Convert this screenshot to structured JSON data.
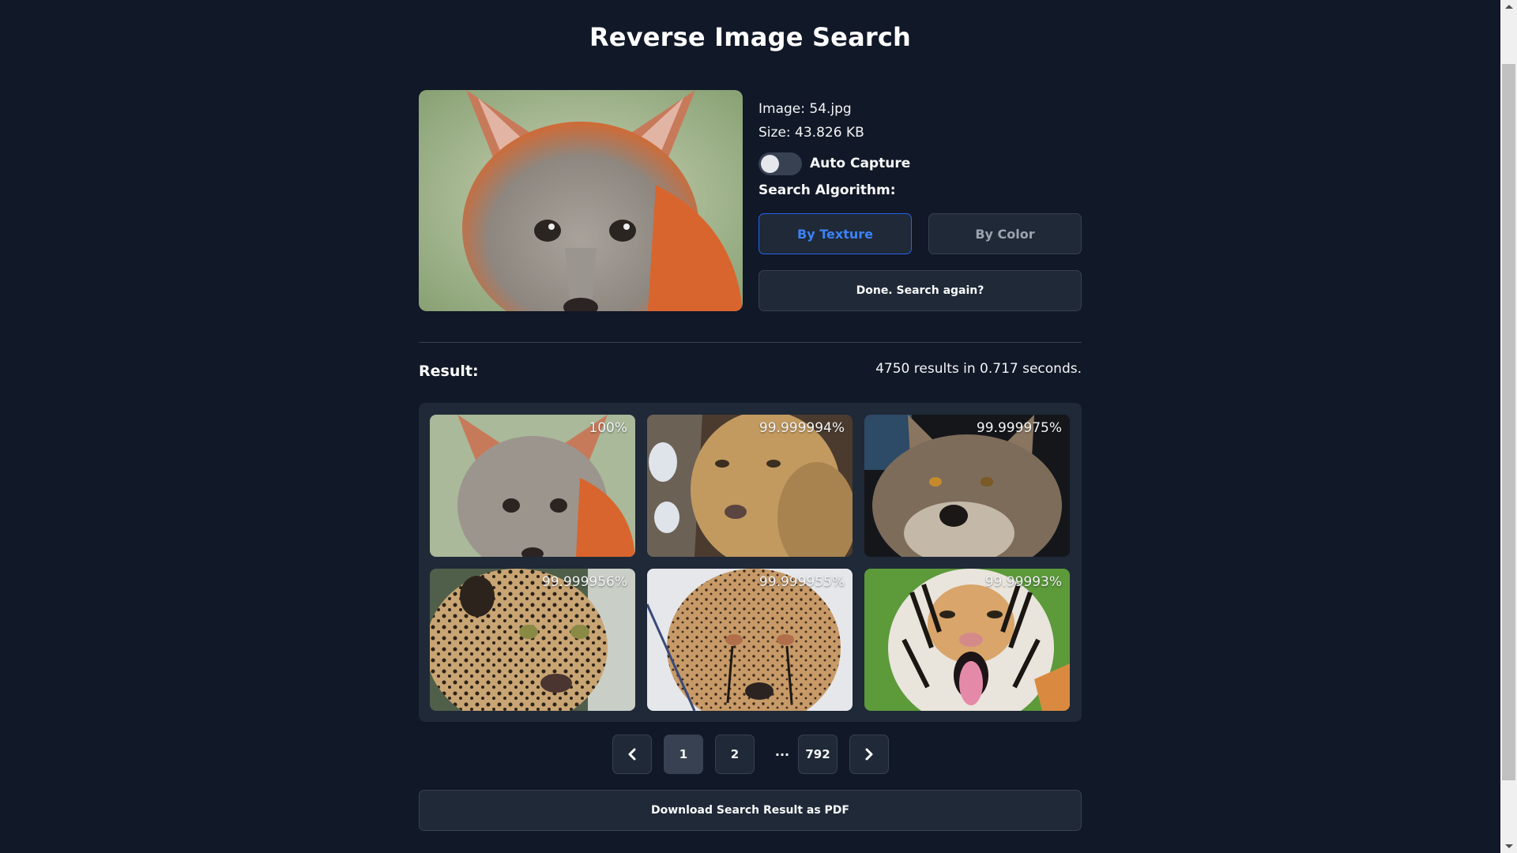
{
  "header": {
    "title": "Reverse Image Search"
  },
  "query": {
    "image_label": "Image: 54.jpg",
    "size_label": "Size: 43.826 KB",
    "image_icon": "fox-photo",
    "auto_capture": {
      "label": "Auto Capture",
      "enabled": false
    },
    "algorithm": {
      "label": "Search Algorithm:",
      "options": [
        {
          "label": "By Texture",
          "selected": true
        },
        {
          "label": "By Color",
          "selected": false
        }
      ]
    },
    "search_again_label": "Done. Search again?"
  },
  "results": {
    "label": "Result:",
    "summary": "4750 results in 0.717 seconds.",
    "items": [
      {
        "subject": "fox",
        "score": "100%"
      },
      {
        "subject": "lioness",
        "score": "99.999994%"
      },
      {
        "subject": "wolf",
        "score": "99.999975%"
      },
      {
        "subject": "leopard",
        "score": "99.999956%"
      },
      {
        "subject": "cheetah",
        "score": "99.999955%"
      },
      {
        "subject": "tiger",
        "score": "99.99993%"
      }
    ]
  },
  "pagination": {
    "prev_icon": "chevron-left-icon",
    "pages": [
      "1",
      "2"
    ],
    "ellipsis": "...",
    "last_page": "792",
    "current_page": "1",
    "next_icon": "chevron-right-icon"
  },
  "download_label": "Download Search Result as PDF",
  "colors": {
    "background": "#111827",
    "panel": "#1f2937",
    "border": "#374151",
    "accent": "#3b82f6",
    "muted_text": "#9ca3af"
  }
}
